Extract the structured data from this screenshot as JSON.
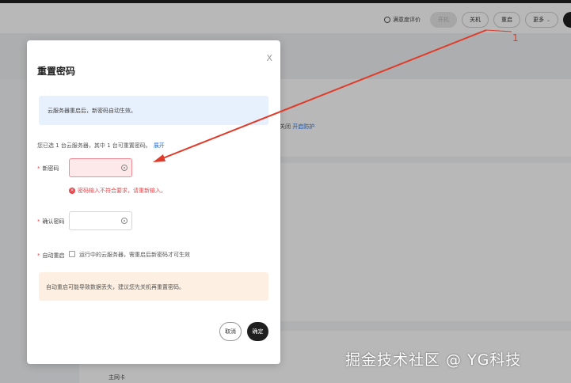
{
  "toolbar": {
    "rate_label": "满意度评价",
    "buttons": {
      "start": "开机",
      "shutdown": "关机",
      "restart": "重启",
      "more": "更多"
    }
  },
  "background": {
    "protect_text": "关闭",
    "protect_link": "开启防护",
    "bottom_label": "主网卡"
  },
  "modal": {
    "title": "重置密码",
    "close": "X",
    "info": "云服务器重启后，新密码自动生效。",
    "summary": "您已选 1 台云服务器，其中 1 台可重置密码。",
    "expand": "展开",
    "new_password": {
      "label": "新密码",
      "error": "密码输入不符合要求，请重新输入。"
    },
    "confirm_password": {
      "label": "确认密码"
    },
    "auto_restart": {
      "label": "自动重启",
      "checkbox_text": "运行中的云服务器，需重启后新密码才可生效"
    },
    "warning": "自动重启可能导致数据丢失，建议您先关机再重置密码。",
    "buttons": {
      "cancel": "取消",
      "ok": "确定"
    }
  },
  "annotation": {
    "number": "1",
    "color": "#e03b2a"
  },
  "watermark": "掘金技术社区 @ YG科技",
  "colors": {
    "error": "#e5484d",
    "link": "#1f6feb",
    "primary_button": "#1f1f1f",
    "info_bg": "#e7f0fd",
    "warning_bg": "#fdf0e2"
  }
}
